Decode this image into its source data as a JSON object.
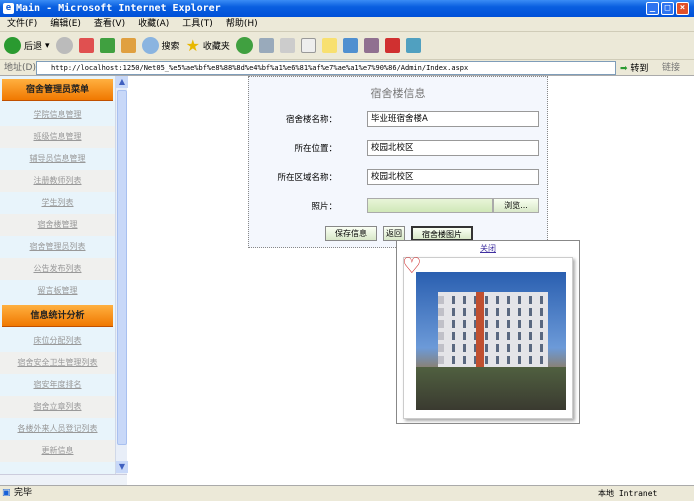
{
  "window": {
    "title": "Main - Microsoft Internet Explorer"
  },
  "menu": [
    "文件(F)",
    "编辑(E)",
    "查看(V)",
    "收藏(A)",
    "工具(T)",
    "帮助(H)"
  ],
  "toolbar": {
    "back": "后退",
    "search": "搜索",
    "favorites": "收藏夹"
  },
  "address": {
    "label": "地址(D)",
    "url": "http://localhost:1250/Net05_%e5%ae%bf%e8%88%8d%e4%bf%a1%e6%81%af%e7%ae%a1%e7%90%86/Admin/Index.aspx",
    "go": "转到",
    "links": "链接"
  },
  "sidebar": {
    "sections": [
      {
        "title": "宿舍管理员菜单",
        "items": [
          "学院信息管理",
          "班级信息管理",
          "辅导员信息管理",
          "注册教师列表",
          "学生列表",
          "宿舍楼管理",
          "宿舍管理员列表",
          "公告发布列表",
          "留言板管理"
        ]
      },
      {
        "title": "信息统计分析",
        "items": [
          "床位分配列表",
          "宿舍安全卫生管理列表",
          "宿安年度排名",
          "宿舍立章列表",
          "各楼外来人员登记列表",
          "更新信息"
        ]
      }
    ]
  },
  "form": {
    "title": "宿舍楼信息",
    "fields": [
      {
        "label": "宿舍楼名称：",
        "value": "毕业班宿舍楼A"
      },
      {
        "label": "所在位置：",
        "value": "校园北校区"
      },
      {
        "label": "所在区域名称：",
        "value": "校园北校区"
      }
    ],
    "photo_label": "照片：",
    "browse": "浏览...",
    "buttons": {
      "save": "保存信息",
      "back": "返回",
      "image": "宿舍楼图片"
    }
  },
  "popup": {
    "close": "关闭"
  },
  "status": {
    "text": "完毕",
    "zone": "本地 Intranet"
  }
}
